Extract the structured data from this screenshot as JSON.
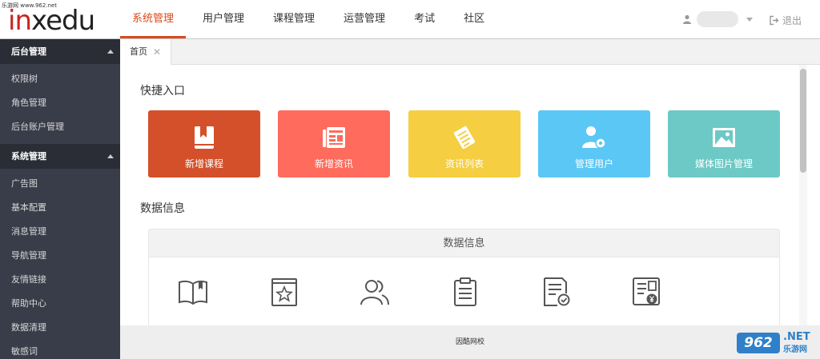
{
  "watermark_top": "乐游网 www.962.net",
  "logo": {
    "text_red": "in",
    "text_dark": "xedu"
  },
  "topnav": [
    {
      "label": "系统管理",
      "active": true
    },
    {
      "label": "用户管理",
      "active": false
    },
    {
      "label": "课程管理",
      "active": false
    },
    {
      "label": "运营管理",
      "active": false
    },
    {
      "label": "考试",
      "active": false
    },
    {
      "label": "社区",
      "active": false
    }
  ],
  "header": {
    "logout_label": "退出"
  },
  "sidebar": {
    "groups": [
      {
        "title": "后台管理",
        "items": [
          "权限树",
          "角色管理",
          "后台账户管理"
        ]
      },
      {
        "title": "系统管理",
        "items": [
          "广告图",
          "基本配置",
          "消息管理",
          "导航管理",
          "友情链接",
          "帮助中心",
          "数据清理",
          "敏感词"
        ]
      }
    ]
  },
  "tabs": [
    {
      "label": "首页"
    }
  ],
  "main": {
    "quick_title": "快捷入口",
    "quick": [
      {
        "label": "新增课程",
        "color": "#d4502a",
        "icon": "book-bookmark-icon"
      },
      {
        "label": "新增资讯",
        "color": "#ff6b5c",
        "icon": "news-icon"
      },
      {
        "label": "资讯列表",
        "color": "#f5ce42",
        "icon": "list-document-icon"
      },
      {
        "label": "管理用户",
        "color": "#5bc7f5",
        "icon": "user-gear-icon"
      },
      {
        "label": "媒体图片管理",
        "color": "#6cc9c6",
        "icon": "image-icon"
      }
    ],
    "data_title": "数据信息",
    "data_panel_title": "数据信息",
    "data_icons": [
      "open-book-icon",
      "starred-book-icon",
      "users-icon",
      "clipboard-icon",
      "document-check-icon",
      "document-yen-icon"
    ]
  },
  "footer": {
    "text": "因酷网校"
  },
  "watermark_bottom": {
    "box": "962",
    "net": ".NET",
    "cn": "乐游网"
  }
}
